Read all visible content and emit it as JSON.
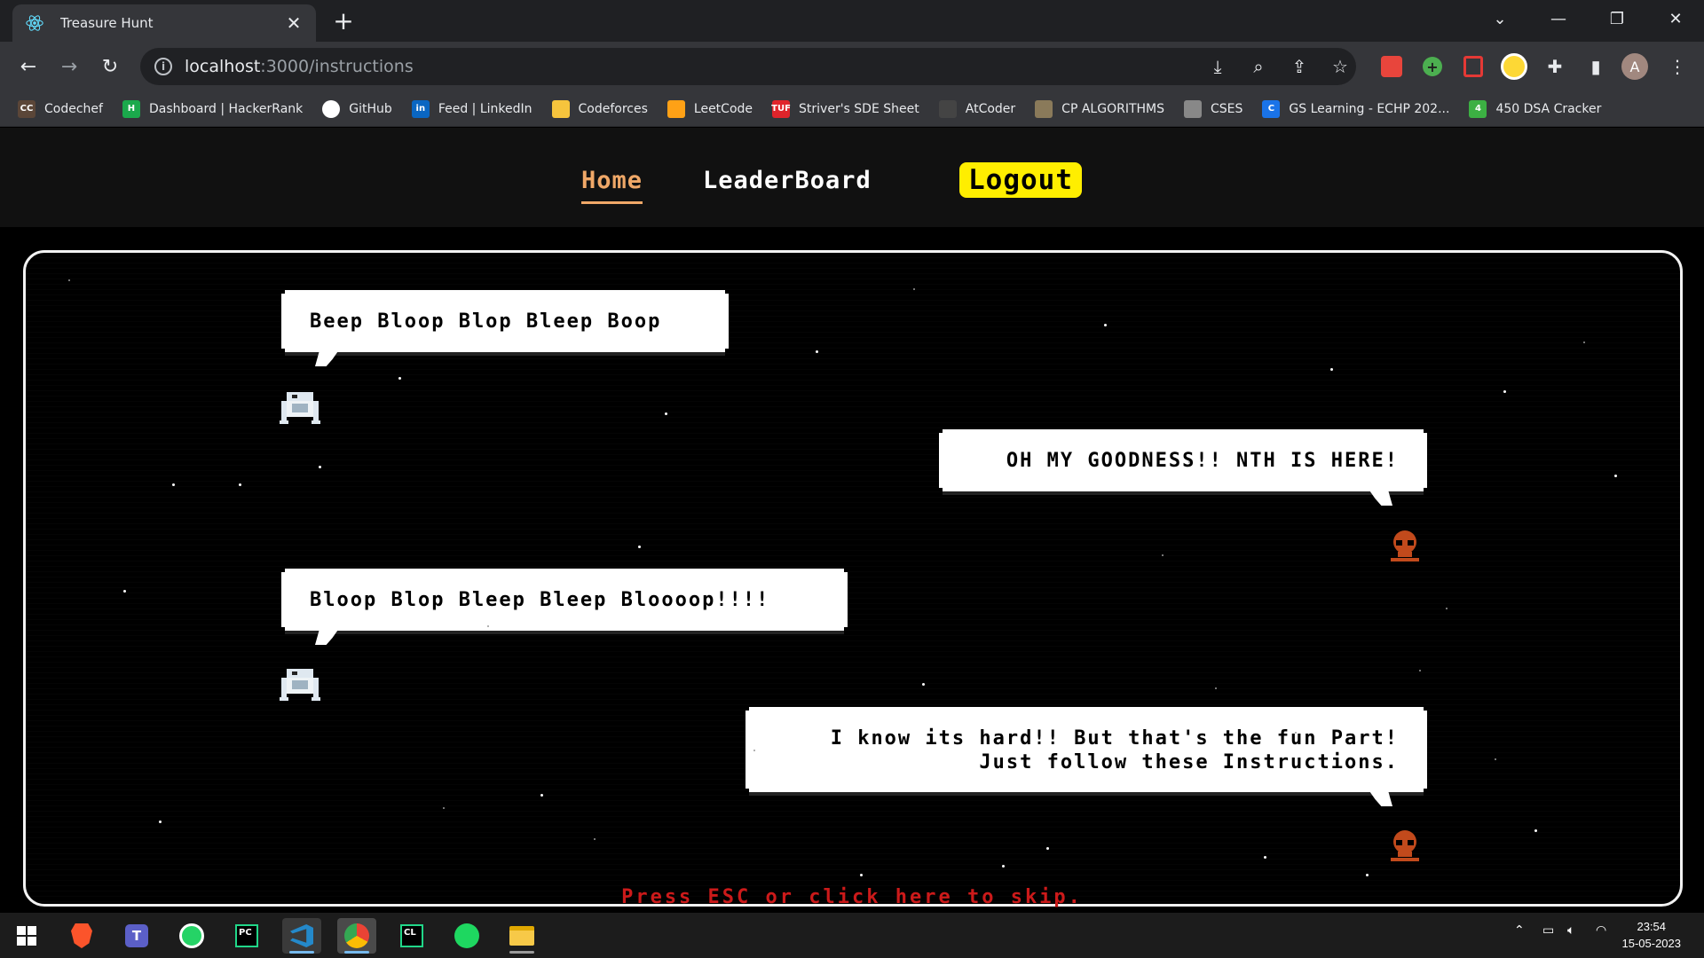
{
  "browser": {
    "tab_title": "Treasure Hunt",
    "url_host": "localhost",
    "url_path": ":3000/instructions",
    "profile_initial": "A",
    "bookmarks": [
      {
        "label": "Codechef",
        "icon": "codechef-icon",
        "color": "#5b4638",
        "glyph": "CC"
      },
      {
        "label": "Dashboard | HackerRank",
        "icon": "hackerrank-icon",
        "color": "#1ba94c",
        "glyph": "H"
      },
      {
        "label": "GitHub",
        "icon": "github-icon",
        "color": "#ffffff",
        "glyph": ""
      },
      {
        "label": "Feed | LinkedIn",
        "icon": "linkedin-icon",
        "color": "#0a66c2",
        "glyph": "in"
      },
      {
        "label": "Codeforces",
        "icon": "codeforces-icon",
        "color": "#f6c43d",
        "glyph": ""
      },
      {
        "label": "LeetCode",
        "icon": "leetcode-icon",
        "color": "#ffa116",
        "glyph": ""
      },
      {
        "label": "Striver's SDE Sheet",
        "icon": "takeuforward-icon",
        "color": "#e0242b",
        "glyph": "TUF"
      },
      {
        "label": "AtCoder",
        "icon": "atcoder-icon",
        "color": "#444444",
        "glyph": ""
      },
      {
        "label": "CP ALGORITHMS",
        "icon": "cp-algorithms-icon",
        "color": "#8a7a5a",
        "glyph": ""
      },
      {
        "label": "CSES",
        "icon": "cses-icon",
        "color": "#888888",
        "glyph": ""
      },
      {
        "label": "GS Learning - ECHP 202...",
        "icon": "gs-learning-icon",
        "color": "#1a73e8",
        "glyph": "C"
      },
      {
        "label": "450 DSA Cracker",
        "icon": "dsa-cracker-icon",
        "color": "#3cb043",
        "glyph": "4"
      }
    ]
  },
  "site": {
    "nav": {
      "home": "Home",
      "leaderboard": "LeaderBoard",
      "logout": "Logout"
    },
    "dialogue": [
      {
        "speaker": "robot",
        "text": "Beep Bloop Blop Bleep Boop"
      },
      {
        "speaker": "skull",
        "text": "OH MY GOODNESS!! NTH IS HERE!"
      },
      {
        "speaker": "robot",
        "text": "Bloop Blop Bleep Bleep Bloooop!!!!"
      },
      {
        "speaker": "skull",
        "line1": "I know its hard!! But that's the fun Part!",
        "line2": "Just follow these Instructions."
      }
    ],
    "skip_text": "Press ESC or click here to skip."
  },
  "colors": {
    "accent_home": "#f0a868",
    "logout_bg": "#ffee00",
    "skip_red": "#cc1a1a",
    "frame_border": "#f2f2f2"
  },
  "taskbar": {
    "time": "23:54",
    "date": "15-05-2023",
    "apps": [
      "windows-start-icon",
      "brave-icon",
      "teams-icon",
      "whatsapp-icon",
      "pycharm-icon",
      "vscode-icon",
      "chrome-icon",
      "clion-icon",
      "spotify-icon",
      "file-explorer-icon"
    ]
  }
}
